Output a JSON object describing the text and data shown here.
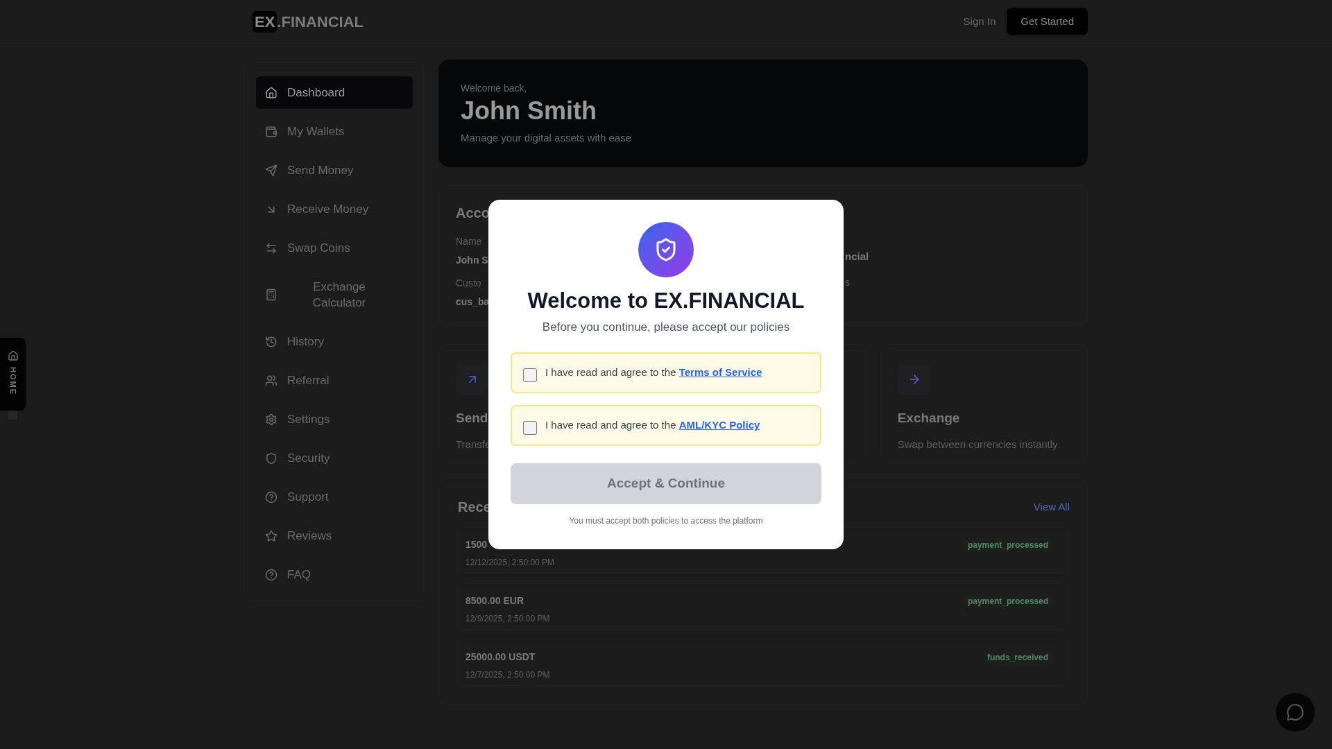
{
  "header": {
    "logo_badge": "EX",
    "logo_text": ".FINANCIAL",
    "sign_in": "Sign In",
    "get_started": "Get Started"
  },
  "sidebar": {
    "items": [
      {
        "label": "Dashboard",
        "selected": true
      },
      {
        "label": "My Wallets",
        "selected": false
      },
      {
        "label": "Send Money",
        "selected": false
      },
      {
        "label": "Receive Money",
        "selected": false
      },
      {
        "label": "Swap Coins",
        "selected": false
      },
      {
        "label": "Exchange Calculator",
        "selected": false
      },
      {
        "label": "History",
        "selected": false
      },
      {
        "label": "Referral",
        "selected": false
      },
      {
        "label": "Settings",
        "selected": false
      },
      {
        "label": "Security",
        "selected": false
      },
      {
        "label": "Support",
        "selected": false
      },
      {
        "label": "Reviews",
        "selected": false
      },
      {
        "label": "FAQ",
        "selected": false
      }
    ]
  },
  "side_tab": {
    "label": "HOME"
  },
  "hero": {
    "greeting": "Welcome back,",
    "name": "John Smith",
    "tagline": "Manage your digital assets with ease"
  },
  "account": {
    "title": "Acco",
    "left_fields": [
      {
        "label": "Name",
        "value": "John S"
      },
      {
        "label": "Custo",
        "value": "cus_ba"
      }
    ],
    "right_fields": [
      {
        "value": "ncial"
      },
      {
        "label": "s"
      }
    ]
  },
  "actions": [
    {
      "title": "Send",
      "description": "Transfe"
    },
    {
      "title": "Exchange",
      "description": "Swap between currencies instantly"
    }
  ],
  "recent": {
    "title": "Rece",
    "view_all": "View All",
    "rows": [
      {
        "amount": "1500",
        "date": "12/12/2025, 2:50:00 PM",
        "status": "payment_processed"
      },
      {
        "amount": "8500.00 EUR",
        "date": "12/9/2025, 2:50:00 PM",
        "status": "payment_processed"
      },
      {
        "amount": "25000.00 USDT",
        "date": "12/7/2025, 2:50:00 PM",
        "status": "funds_received"
      }
    ]
  },
  "modal": {
    "title": "Welcome to EX.FINANCIAL",
    "subtitle": "Before you continue, please accept our policies",
    "policies": [
      {
        "text": "I have read and agree to the ",
        "link": "Terms of Service",
        "checked": false
      },
      {
        "text": "I have read and agree to the ",
        "link": "AML/KYC Policy",
        "checked": false
      }
    ],
    "button": {
      "label": "Accept & Continue",
      "disabled": true
    },
    "note": "You must accept both policies to access the platform"
  }
}
